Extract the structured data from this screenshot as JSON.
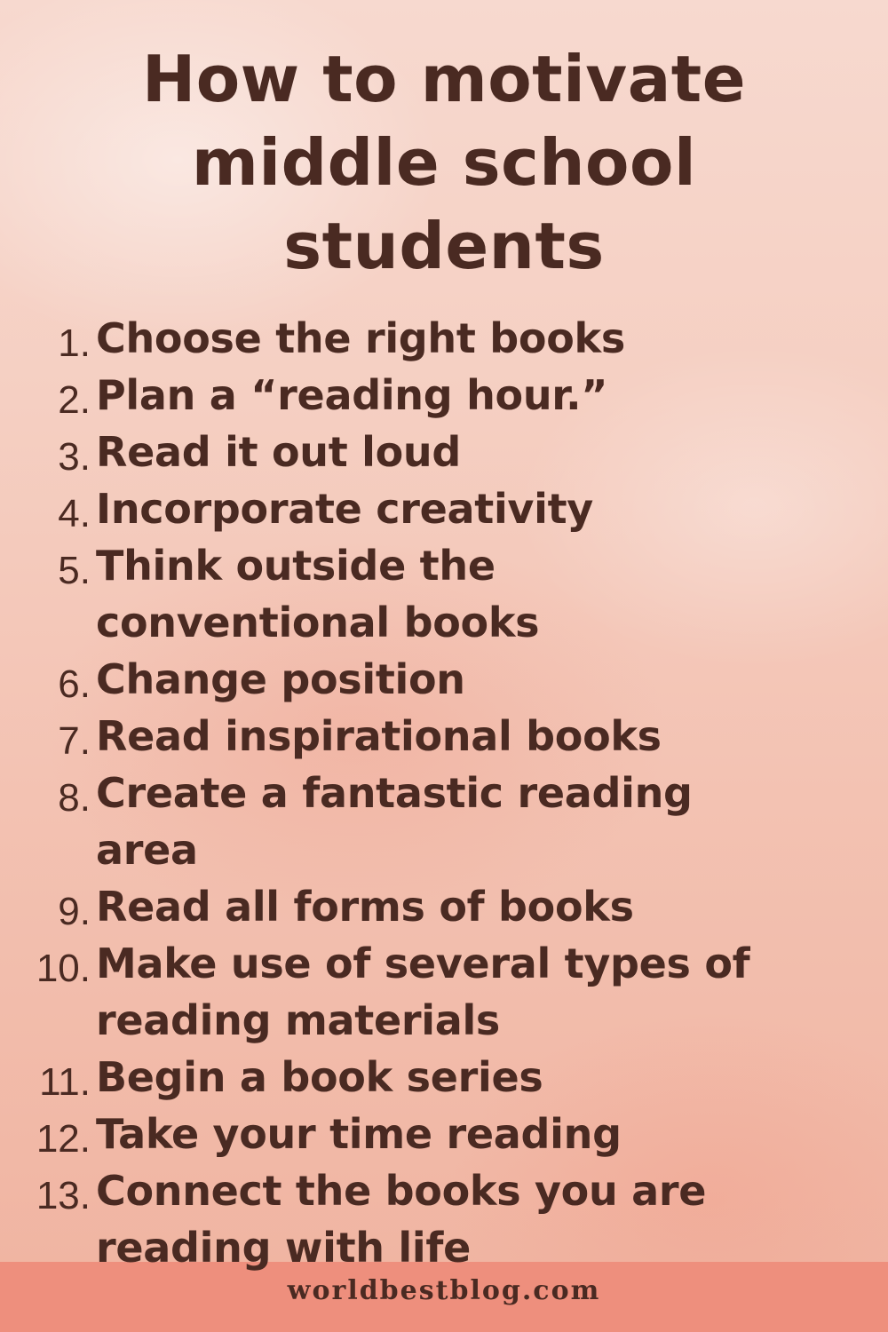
{
  "title": {
    "line1": "How to motivate",
    "line2": "middle school",
    "line3": "students"
  },
  "items": [
    {
      "num": "1.",
      "text": "Choose the right books"
    },
    {
      "num": "2.",
      "text": "Plan a “reading hour.”"
    },
    {
      "num": "3.",
      "text": "Read it out loud"
    },
    {
      "num": "4.",
      "text": "Incorporate creativity"
    },
    {
      "num": "5.",
      "text": "Think outside the conventional books"
    },
    {
      "num": "6.",
      "text": "Change position"
    },
    {
      "num": "7.",
      "text": "Read inspirational books"
    },
    {
      "num": "8.",
      "text": "Create a fantastic reading area"
    },
    {
      "num": "9.",
      "text": "Read all forms of books"
    },
    {
      "num": "10.",
      "text": "Make use of several types of reading materials"
    },
    {
      "num": "11.",
      "text": "Begin a book series"
    },
    {
      "num": "12.",
      "text": "Take your time reading"
    },
    {
      "num": "13.",
      "text": "Connect the books you are reading with life"
    }
  ],
  "footer": {
    "site": "worldbestblog.com"
  },
  "colors": {
    "text": "#4a2a22",
    "footer_bar": "#ee8f7d",
    "background_top": "#f7d9cf",
    "background_bottom": "#f0b3a0"
  }
}
